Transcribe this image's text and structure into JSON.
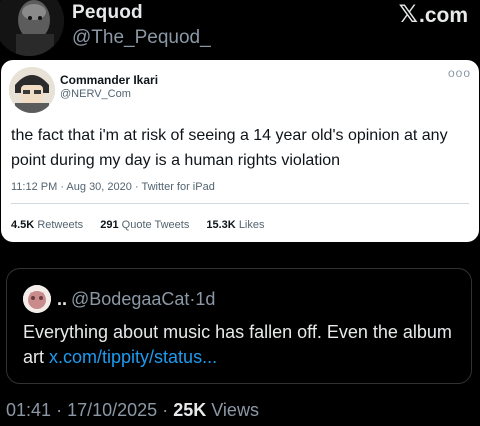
{
  "header": {
    "display_name": "Pequod",
    "handle": "@The_Pequod_",
    "brand_x": "𝕏",
    "brand_text": ".com"
  },
  "screenshot": {
    "display_name": "Commander Ikari",
    "handle": "@NERV_Com",
    "more_icon": "ooo",
    "text": "the fact that i'm at risk of seeing a 14 year old's opinion at any point during my day is a human rights violation",
    "meta": "11:12 PM · Aug 30, 2020 · Twitter for iPad",
    "stats": {
      "retweets_count": "4.5K",
      "retweets_label": "Retweets",
      "quotes_count": "291",
      "quotes_label": "Quote Tweets",
      "likes_count": "15.3K",
      "likes_label": "Likes"
    }
  },
  "quote": {
    "prefix": "..",
    "handle": "@BodegaaCat",
    "separator": "·",
    "time": "1d",
    "text": "Everything about music has fallen off. Even the album art ",
    "link": "x.com/tippity/status..."
  },
  "footer": {
    "time": "01:41",
    "separator": "·",
    "date": "17/10/2025",
    "separator2": "·",
    "views_count": "25K",
    "views_label": "Views"
  },
  "colors": {
    "background": "#000000",
    "link": "#1d9bf0",
    "muted": "#8b98a5",
    "card": "#ffffff"
  }
}
